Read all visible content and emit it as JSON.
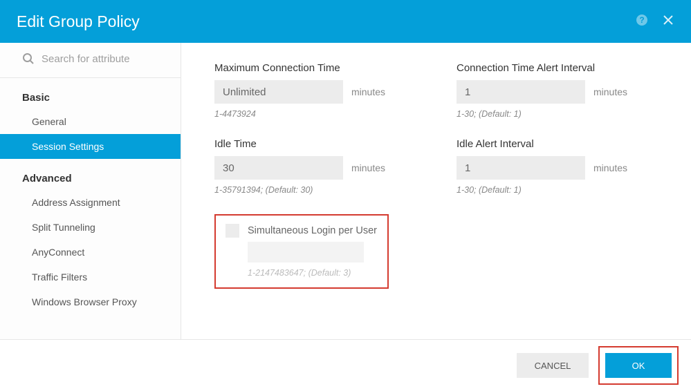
{
  "header": {
    "title": "Edit Group Policy"
  },
  "search": {
    "placeholder": "Search for attribute"
  },
  "nav": {
    "sections": [
      {
        "title": "Basic",
        "items": [
          {
            "label": "General",
            "active": false
          },
          {
            "label": "Session Settings",
            "active": true
          }
        ]
      },
      {
        "title": "Advanced",
        "items": [
          {
            "label": "Address Assignment",
            "active": false
          },
          {
            "label": "Split Tunneling",
            "active": false
          },
          {
            "label": "AnyConnect",
            "active": false
          },
          {
            "label": "Traffic Filters",
            "active": false
          },
          {
            "label": "Windows Browser Proxy",
            "active": false
          }
        ]
      }
    ]
  },
  "fields": {
    "maxConnTime": {
      "label": "Maximum Connection Time",
      "value": "Unlimited",
      "unit": "minutes",
      "hint": "1-4473924"
    },
    "idleTime": {
      "label": "Idle Time",
      "value": "30",
      "unit": "minutes",
      "hint": "1-35791394; (Default: 30)"
    },
    "connAlertInterval": {
      "label": "Connection Time Alert Interval",
      "value": "1",
      "unit": "minutes",
      "hint": "1-30; (Default: 1)"
    },
    "idleAlertInterval": {
      "label": "Idle Alert Interval",
      "value": "1",
      "unit": "minutes",
      "hint": "1-30; (Default: 1)"
    },
    "simLogin": {
      "label": "Simultaneous Login per User",
      "value": "",
      "hint": "1-2147483647; (Default: 3)"
    }
  },
  "footer": {
    "cancel": "CANCEL",
    "ok": "OK"
  }
}
